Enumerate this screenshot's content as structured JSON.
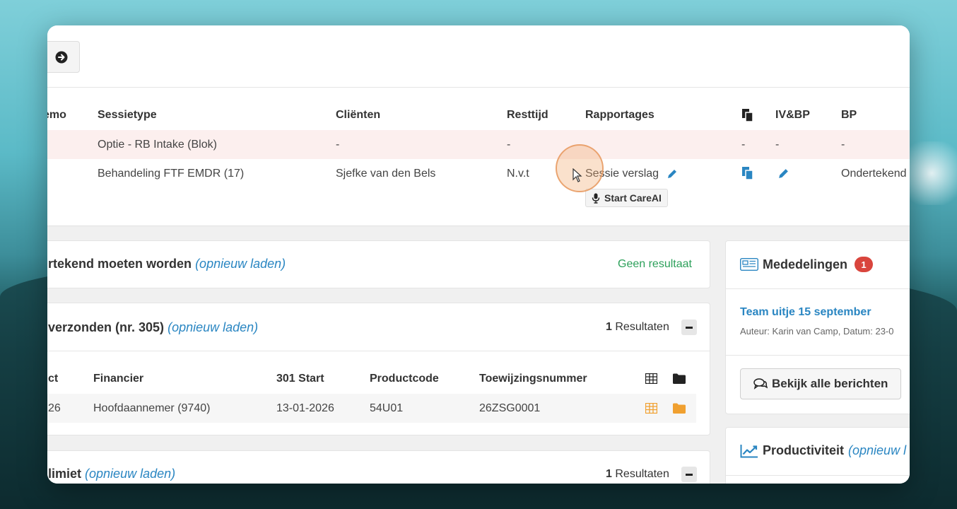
{
  "sessions": {
    "headers": {
      "memo": "emo",
      "type": "Sessietype",
      "clients": "Cliënten",
      "remaining": "Resttijd",
      "reports": "Rapportages",
      "ivbp": "IV&BP",
      "bp": "BP"
    },
    "rows": [
      {
        "type": "Optie - RB Intake (Blok)",
        "clients": "-",
        "remaining": "-",
        "reports": "",
        "copy": "-",
        "ivbp": "-",
        "bp": "-"
      },
      {
        "type": "Behandeling FTF EMDR (17)",
        "clients": "Sjefke van den Bels",
        "remaining": "N.v.t",
        "reports": "Sessie verslag",
        "bp": "Ondertekend"
      }
    ],
    "careai_label": "Start CareAI"
  },
  "card_sign": {
    "title": "rtekend moeten worden",
    "reload": "(opnieuw laden)",
    "result": "Geen resultaat"
  },
  "card_sent": {
    "title": "verzonden (nr. 305)",
    "reload": "(opnieuw laden)",
    "count": "1",
    "count_label": "Resultaten",
    "headers": {
      "product": "ct",
      "financer": "Financier",
      "start": "301 Start",
      "code": "Productcode",
      "assignment": "Toewijzingsnummer"
    },
    "row": {
      "product": "26",
      "financer": "Hoofdaannemer (9740)",
      "start": "13-01-2026",
      "code": "54U01",
      "assignment": "26ZSG0001"
    }
  },
  "card_limit": {
    "title": "limiet",
    "reload": "(opnieuw laden)",
    "count": "1",
    "count_label": "Resultaten"
  },
  "news": {
    "title": "Mededelingen",
    "badge": "1",
    "item_title": "Team uitje 15 september",
    "item_meta": "Auteur: Karin van Camp, Datum: 23-0",
    "all_button": "Bekijk alle berichten"
  },
  "productivity": {
    "title": "Productiviteit",
    "reload": "(opnieuw l"
  },
  "colors": {
    "link": "#2a86c2",
    "success": "#2ca05a",
    "badge": "#d9453d",
    "orange": "#f0a030"
  }
}
